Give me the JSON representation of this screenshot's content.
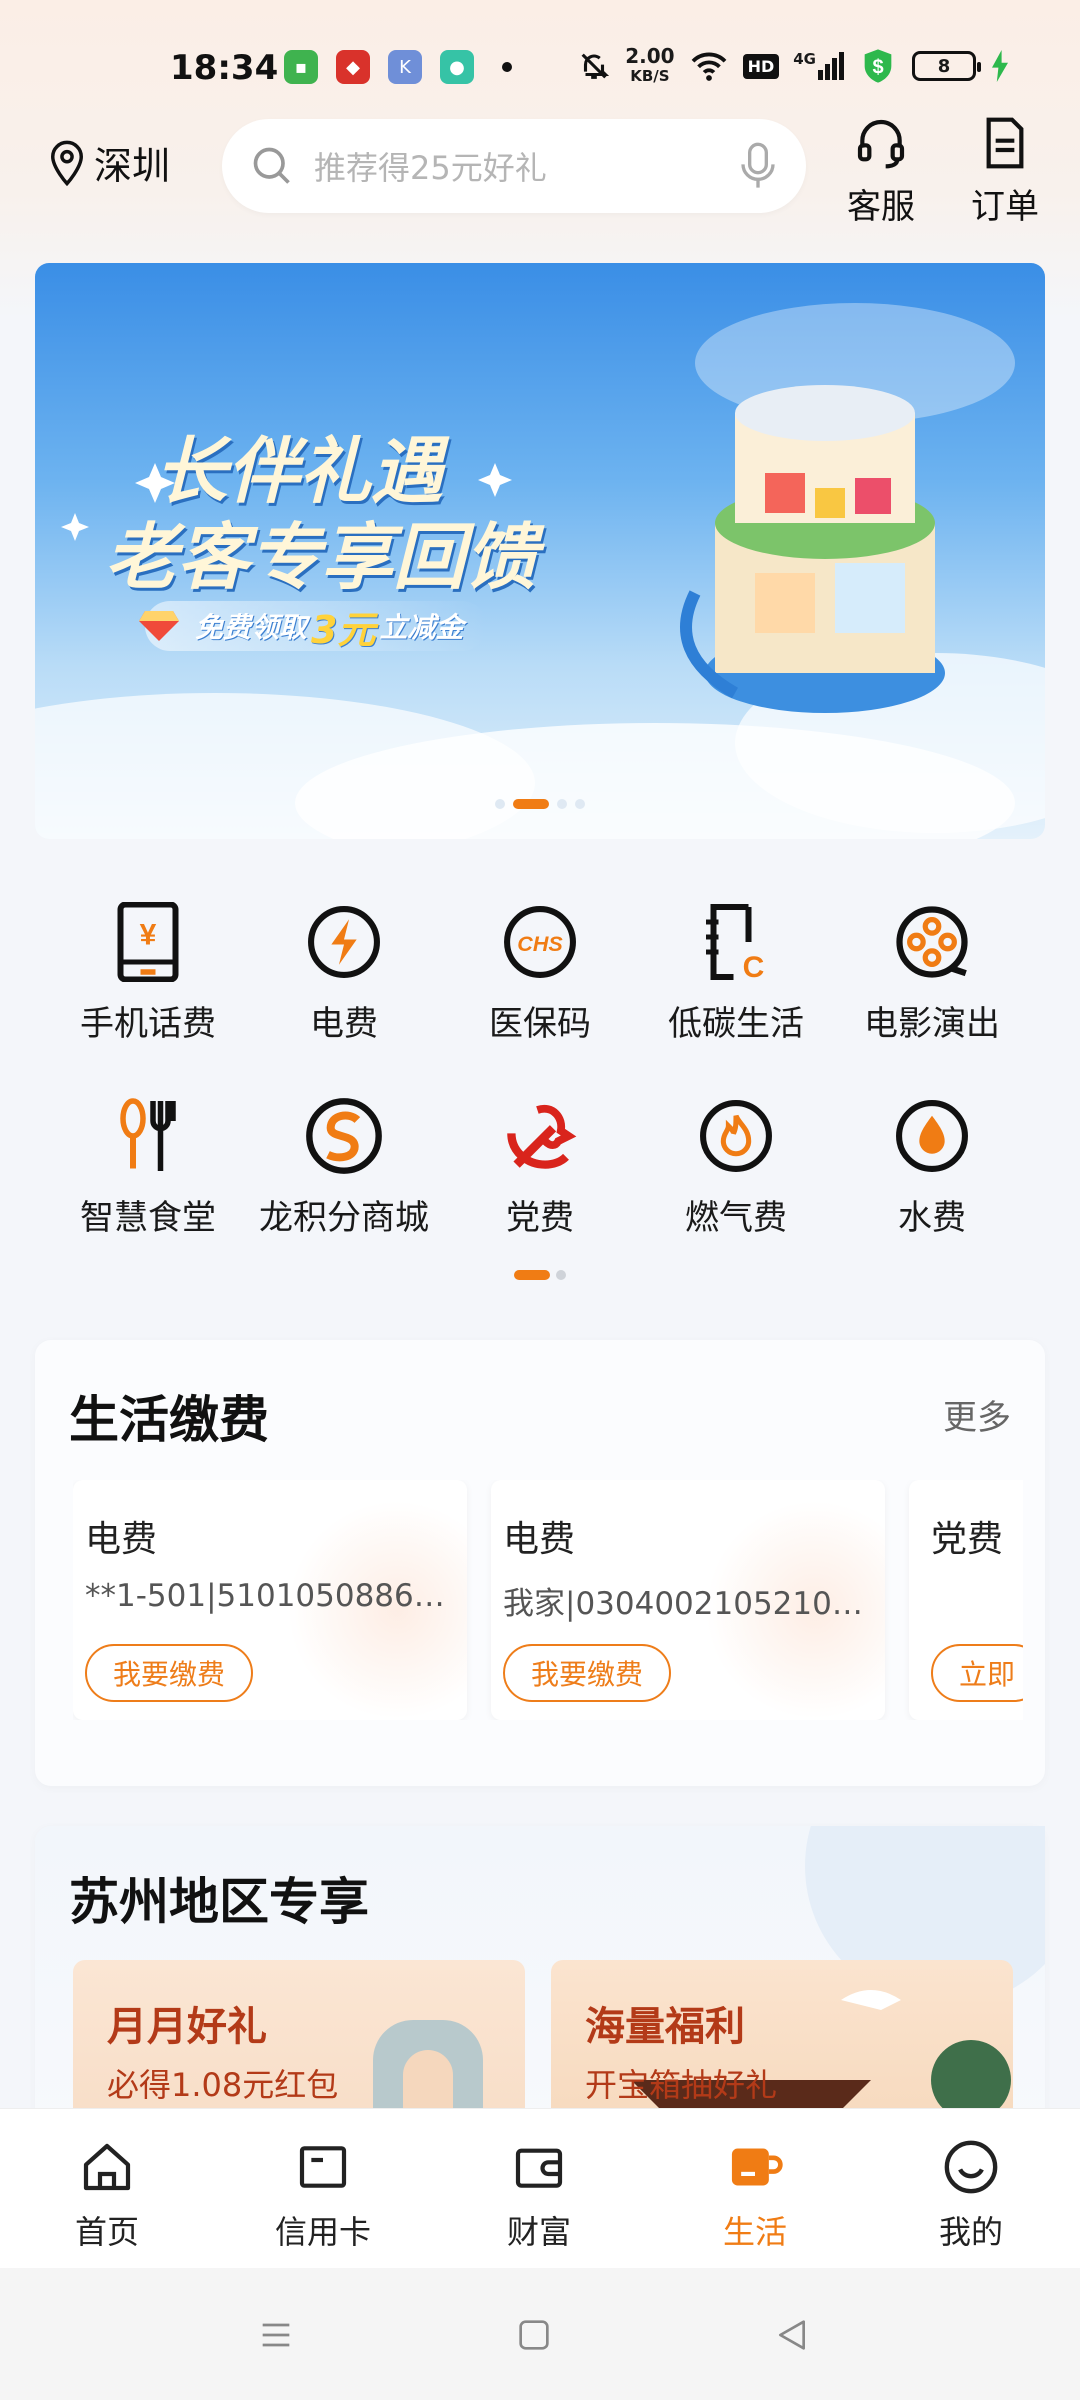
{
  "status_bar": {
    "time": "18:34",
    "net_speed": "2.00",
    "net_unit": "KB/S",
    "hd": "HD",
    "network": "4G",
    "battery": "8"
  },
  "header": {
    "location": "深圳",
    "search_placeholder": "推荐得25元好礼",
    "service_label": "客服",
    "orders_label": "订单"
  },
  "banner": {
    "title_line1": "长伴礼遇",
    "title_line2": "老客专享回馈",
    "sub_prefix": "免费领取",
    "sub_highlight": "3元",
    "sub_suffix": "立减金"
  },
  "grid": {
    "items": [
      {
        "label": "手机话费",
        "icon": "phone-bill-icon"
      },
      {
        "label": "电费",
        "icon": "electricity-icon"
      },
      {
        "label": "医保码",
        "icon": "medical-insurance-icon"
      },
      {
        "label": "低碳生活",
        "icon": "low-carbon-icon"
      },
      {
        "label": "电影演出",
        "icon": "film-reel-icon"
      },
      {
        "label": "智慧食堂",
        "icon": "canteen-icon"
      },
      {
        "label": "龙积分商城",
        "icon": "points-mall-icon"
      },
      {
        "label": "党费",
        "icon": "party-fee-icon"
      },
      {
        "label": "燃气费",
        "icon": "gas-fee-icon"
      },
      {
        "label": "水费",
        "icon": "water-fee-icon"
      }
    ]
  },
  "life_payment": {
    "title": "生活缴费",
    "more": "更多",
    "items": [
      {
        "name": "电费",
        "account": "**1-501|51010508867...",
        "button": "我要缴费"
      },
      {
        "name": "电费",
        "account": "我家|03040021052103...",
        "button": "我要缴费"
      },
      {
        "name": "党费",
        "account": "",
        "button": "立即"
      }
    ]
  },
  "regional": {
    "title": "苏州地区专享",
    "promos": [
      {
        "title": "月月好礼",
        "subtitle": "必得1.08元红包"
      },
      {
        "title": "海量福利",
        "subtitle": "开宝箱抽好礼"
      }
    ]
  },
  "bottom_nav": {
    "items": [
      {
        "label": "首页"
      },
      {
        "label": "信用卡"
      },
      {
        "label": "财富"
      },
      {
        "label": "生活"
      },
      {
        "label": "我的"
      }
    ]
  },
  "colors": {
    "accent": "#f07c14",
    "brand_orange": "#ee7d1a",
    "text_primary": "#111111",
    "text_secondary": "#666666"
  }
}
